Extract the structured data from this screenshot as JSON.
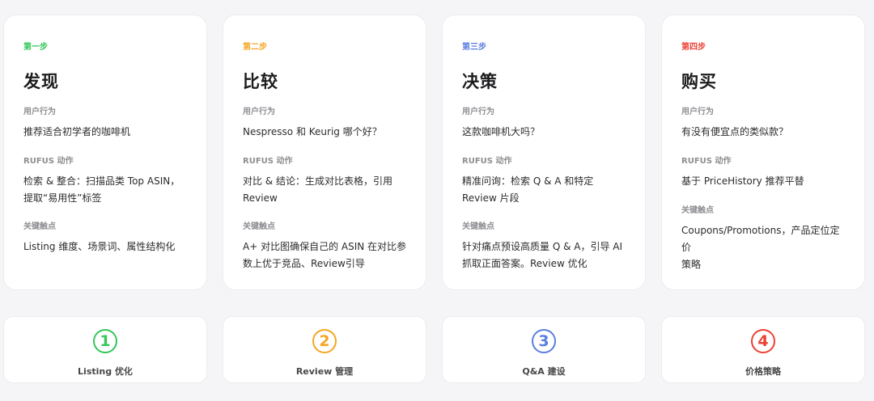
{
  "colors": {
    "step1": "#34c759",
    "step2": "#f5a623",
    "step3": "#5b7fe0",
    "step4": "#ec4135"
  },
  "steps": [
    {
      "label": "第一步",
      "title": "发现",
      "behavior_head": "用户行为",
      "behavior": "推荐适合初学者的咖啡机",
      "action_head": "RUFUS 动作",
      "action_1": "检索 & 整合：扫描品类 Top ASIN，",
      "action_2": "提取“易用性”标签",
      "touch_head": "关键触点",
      "touch_1": "Listing 维度、场景词、属性结构化",
      "touch_2": ""
    },
    {
      "label": "第二步",
      "title": "比较",
      "behavior_head": "用户行为",
      "behavior": "Nespresso 和 Keurig 哪个好？",
      "action_head": "RUFUS 动作",
      "action_1": "对比 & 结论：生成对比表格，引用",
      "action_2": "Review",
      "touch_head": "关键触点",
      "touch_1": "A+ 对比图确保自己的 ASIN 在对比参",
      "touch_2": "数上优于竞品、Review引导"
    },
    {
      "label": "第三步",
      "title": "决策",
      "behavior_head": "用户行为",
      "behavior": "这款咖啡机大吗？",
      "action_head": "RUFUS 动作",
      "action_1": "精准问询：检索 Q & A 和特定",
      "action_2": "Review 片段",
      "touch_head": "关键触点",
      "touch_1": "针对痛点预设高质量 Q & A，引导 AI",
      "touch_2": "抓取正面答案。Review 优化"
    },
    {
      "label": "第四步",
      "title": "购买",
      "behavior_head": "用户行为",
      "behavior": "有没有便宜点的类似款？",
      "action_head": "RUFUS 动作",
      "action_1": "基于 PriceHistory 推荐平替",
      "action_2": "",
      "touch_head": "关键触点",
      "touch_1": "Coupons/Promotions，产品定位定价",
      "touch_2": "策略"
    }
  ],
  "bottom": [
    {
      "num": "1",
      "label": "Listing 优化",
      "icon": "circled-number-1-icon"
    },
    {
      "num": "2",
      "label": "Review 管理",
      "icon": "circled-number-2-icon"
    },
    {
      "num": "3",
      "label": "Q&A 建设",
      "icon": "circled-number-3-icon"
    },
    {
      "num": "4",
      "label": "价格策略",
      "icon": "circled-number-4-icon"
    }
  ]
}
